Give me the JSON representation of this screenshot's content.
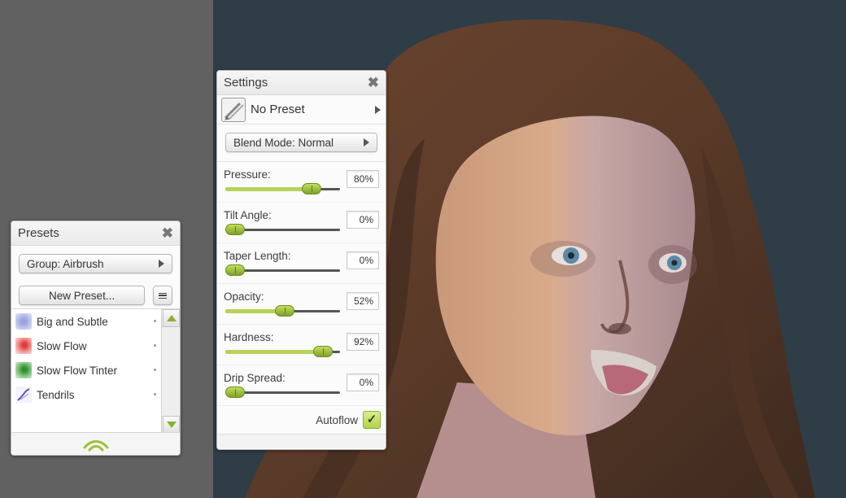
{
  "colors": {
    "accent_green": "#a8c83c",
    "canvas_bg": "#2f3d47",
    "workspace_bg": "#616161",
    "panel_bg": "#fbfbfb"
  },
  "settings_panel": {
    "title": "Settings",
    "close_icon": "close-icon",
    "preset_icon": "brush-thumbnail-icon",
    "preset_name": "No Preset",
    "blend_mode_label": "Blend Mode: Normal",
    "sliders": [
      {
        "label": "Pressure:",
        "value_text": "80%",
        "level": 0.8
      },
      {
        "label": "Tilt Angle:",
        "value_text": "0%",
        "level": 0.0
      },
      {
        "label": "Taper Length:",
        "value_text": "0%",
        "level": 0.0
      },
      {
        "label": "Opacity:",
        "value_text": "52%",
        "level": 0.52
      },
      {
        "label": "Hardness:",
        "value_text": "92%",
        "level": 0.92
      },
      {
        "label": "Drip Spread:",
        "value_text": "0%",
        "level": 0.0
      }
    ],
    "autoflow_label": "Autoflow",
    "autoflow_checked": true,
    "autoflow_check_glyph": "✓"
  },
  "presets_panel": {
    "title": "Presets",
    "close_icon": "close-icon",
    "group_label": "Group: Airbrush",
    "new_preset_label": "New Preset...",
    "items": [
      {
        "label": "Big and Subtle",
        "swatch_icon": "soft-blue-swatch-icon",
        "color": "#8f9ad6"
      },
      {
        "label": "Slow Flow",
        "swatch_icon": "red-swatch-icon",
        "color": "#e24a4a"
      },
      {
        "label": "Slow Flow Tinter",
        "swatch_icon": "green-swatch-icon",
        "color": "#3e9a3e"
      },
      {
        "label": "Tendrils",
        "swatch_icon": "tendrils-swatch-icon",
        "color": "#6a4fb0"
      }
    ]
  },
  "canvas": {
    "subject": "painted-portrait"
  }
}
